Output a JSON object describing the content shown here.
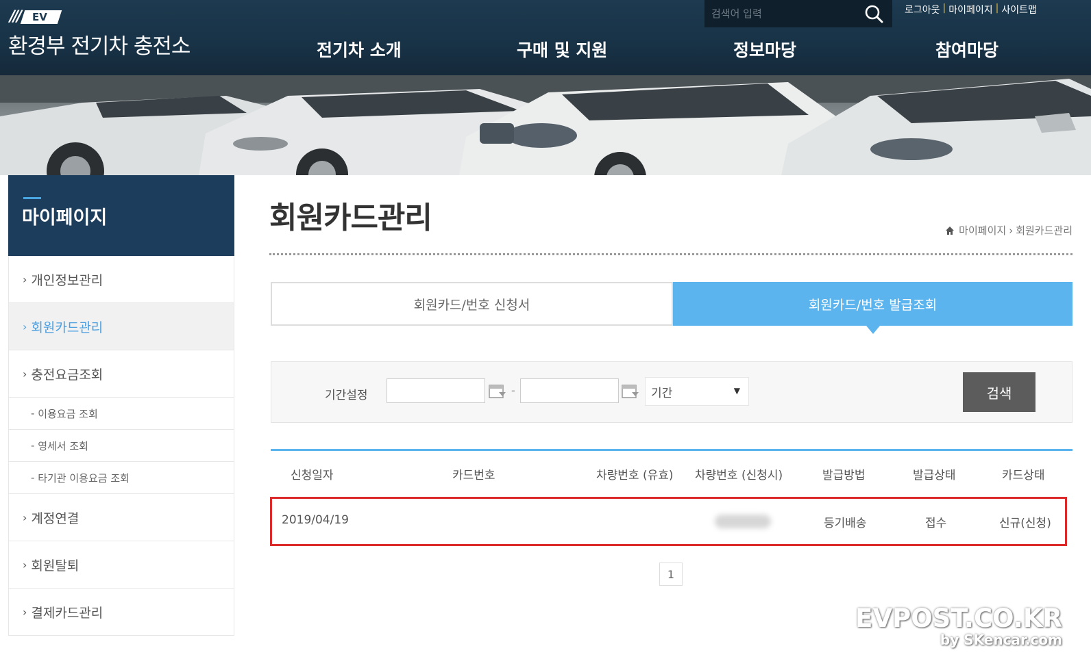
{
  "header": {
    "logo_mark": "EV",
    "site_title": "환경부 전기차 충전소",
    "search_placeholder": "검색어 입력",
    "util_links": [
      "로그아웃",
      "마이페이지",
      "사이트맵"
    ],
    "nav": [
      "전기차 소개",
      "구매 및 지원",
      "정보마당",
      "참여마당"
    ]
  },
  "sidebar": {
    "title": "마이페이지",
    "items": [
      {
        "label": "개인정보관리"
      },
      {
        "label": "회원카드관리",
        "active": true
      },
      {
        "label": "충전요금조회"
      },
      {
        "label": "계정연결"
      },
      {
        "label": "회원탈퇴"
      },
      {
        "label": "결제카드관리"
      }
    ],
    "subitems": [
      "이용요금 조회",
      "영세서 조회",
      "타기관 이용요금 조회"
    ]
  },
  "page": {
    "title": "회원카드관리",
    "breadcrumb": [
      "마이페이지",
      "회원카드관리"
    ]
  },
  "tabs": [
    {
      "label": "회원카드/번호 신청서",
      "active": false
    },
    {
      "label": "회원카드/번호 발급조회",
      "active": true
    }
  ],
  "filter": {
    "label": "기간설정",
    "start_date": "",
    "end_date": "",
    "dash": "-",
    "period_selected": "기간",
    "search_button": "검색"
  },
  "table": {
    "headers": [
      "신청일자",
      "카드번호",
      "차량번호 (유효)",
      "차량번호 (신청시)",
      "발급방법",
      "발급상태",
      "카드상태"
    ],
    "rows": [
      {
        "date": "2019/04/19",
        "card_no": "",
        "car_valid": "",
        "car_applied": "",
        "method": "등기배송",
        "issue_status": "접수",
        "card_status": "신규(신청)"
      }
    ]
  },
  "pagination": {
    "current": "1"
  },
  "watermark": {
    "line1": "EVPOST.CO.KR",
    "line2": "by SKencar.com"
  },
  "colors": {
    "header_bg": "#1d3a50",
    "accent": "#5cb4ee",
    "highlight": "#dc2a2a",
    "sidebar_head": "#1c3d5c"
  }
}
